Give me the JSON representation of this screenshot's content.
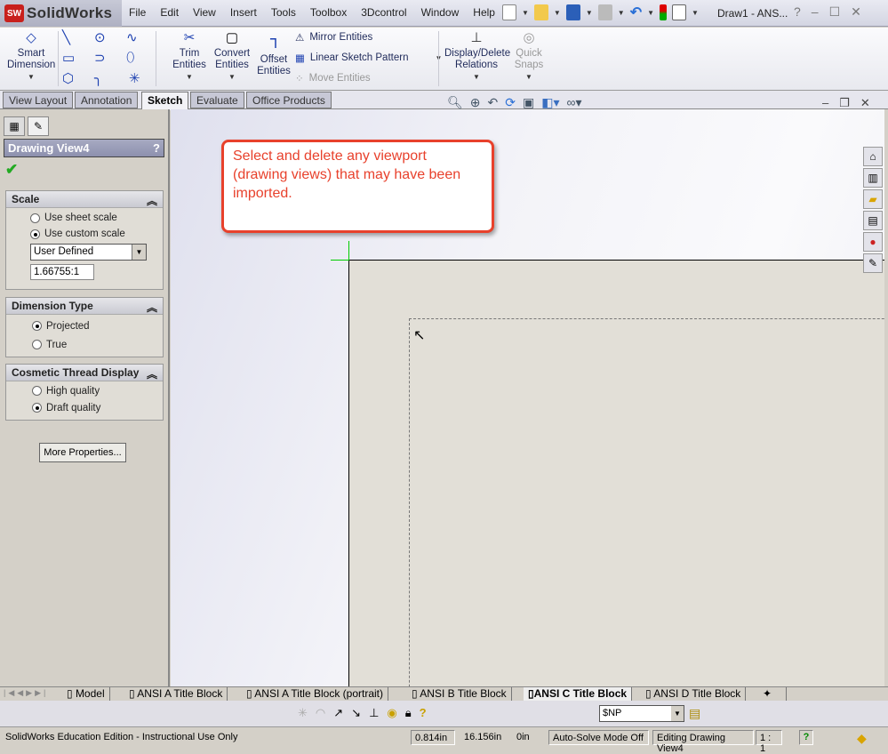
{
  "app": {
    "logo_text": "SolidWorks",
    "logo_badge": "SW",
    "doc_title": "Draw1 - ANS...",
    "help": "?"
  },
  "menu": [
    "File",
    "Edit",
    "View",
    "Insert",
    "Tools",
    "Toolbox",
    "3Dcontrol",
    "Window",
    "Help"
  ],
  "command_manager": {
    "smart_dimension": "Smart Dimension",
    "trim": "Trim Entities",
    "convert": "Convert Entities",
    "offset": "Offset Entities",
    "mirror": "Mirror Entities",
    "linear_pattern": "Linear Sketch Pattern",
    "move": "Move Entities",
    "display_delete": "Display/Delete Relations",
    "quick_snaps": "Quick Snaps"
  },
  "tabs": [
    {
      "label": "View Layout"
    },
    {
      "label": "Annotation"
    },
    {
      "label": "Sketch",
      "active": true
    },
    {
      "label": "Evaluate"
    },
    {
      "label": "Office Products"
    }
  ],
  "property_manager": {
    "title": "Drawing View4",
    "help": "?",
    "scale": {
      "title": "Scale",
      "options": [
        "Use sheet scale",
        "Use custom scale"
      ],
      "selected": "Use custom scale",
      "dropdown": "User Defined",
      "value": "1.66755:1"
    },
    "dimension_type": {
      "title": "Dimension Type",
      "options": [
        "Projected",
        "True"
      ],
      "selected": "Projected"
    },
    "cosmetic_thread": {
      "title": "Cosmetic Thread Display",
      "options": [
        "High quality",
        "Draft quality"
      ],
      "selected": "Draft quality"
    },
    "more_properties": "More Properties..."
  },
  "callout": "Select and delete any viewport (drawing views) that may have been imported.",
  "sheet_tabs": [
    {
      "label": "Model"
    },
    {
      "label": "ANSI A Title Block"
    },
    {
      "label": "ANSI A Title Block (portrait)"
    },
    {
      "label": "ANSI B Title Block"
    },
    {
      "label": "ANSI C Title Block",
      "active": true
    },
    {
      "label": "ANSI D Title Block"
    }
  ],
  "layer": {
    "value": "$NP"
  },
  "status": {
    "edition": "SolidWorks Education Edition - Instructional Use Only",
    "x": "0.814in",
    "y": "16.156in",
    "z": "0in",
    "solve": "Auto-Solve Mode Off",
    "editing": "Editing Drawing View4",
    "scale": "1 : 1",
    "help": "?"
  },
  "colors": {
    "callout": "#e8412c",
    "sheet": "#e2dfd7",
    "accent": "#1b3fb0"
  }
}
